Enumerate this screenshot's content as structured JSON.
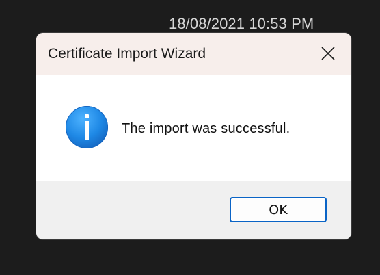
{
  "desktop": {
    "timestamp": "18/08/2021 10:53 PM"
  },
  "dialog": {
    "title": "Certificate Import Wizard",
    "close_icon": "close-icon",
    "info_icon": "info-icon",
    "message": "The import was successful.",
    "ok_label": "OK"
  },
  "colors": {
    "desktop_bg": "#1c1c1c",
    "titlebar_bg": "#f7eeeb",
    "content_bg": "#ffffff",
    "footer_bg": "#f0f0f0",
    "accent": "#0a64c6",
    "info_icon_blue": "#1e88e5"
  }
}
